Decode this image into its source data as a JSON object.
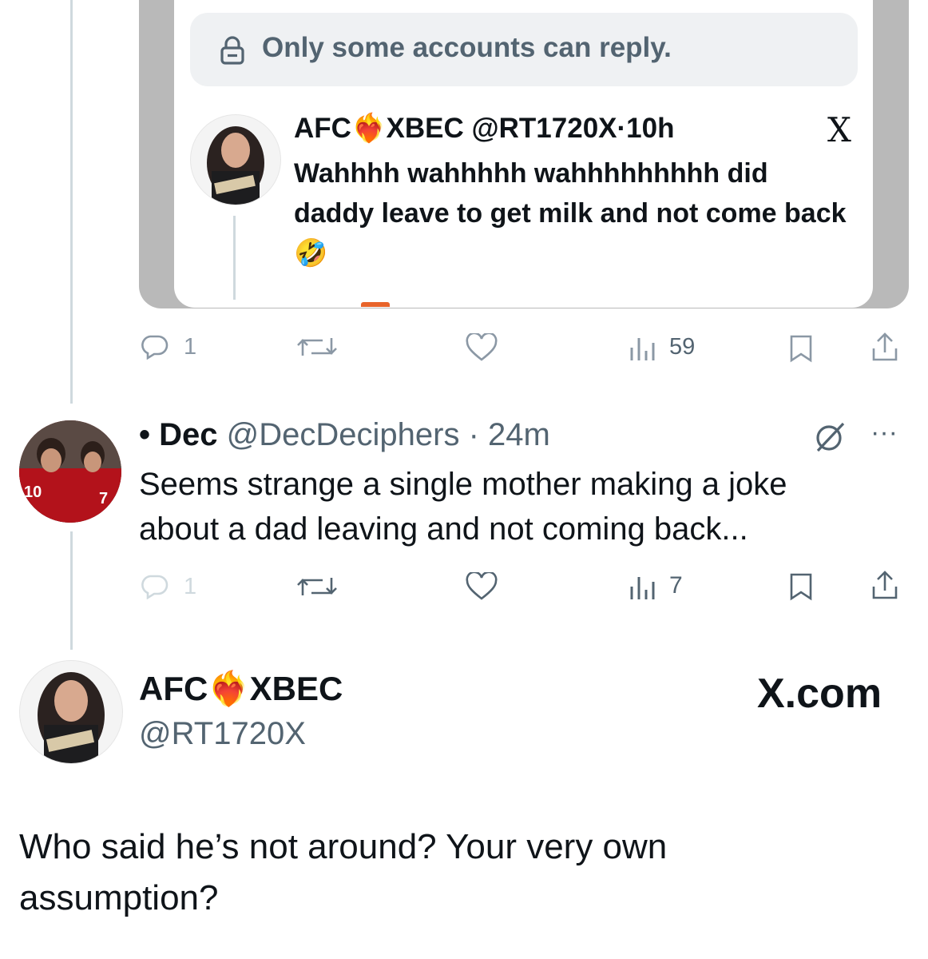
{
  "quoted_post": {
    "reply_notice": "Only some accounts can reply.",
    "author_name_left": "AFC",
    "author_name_right": "XBEC",
    "handle": "@RT1720X",
    "time": "10h",
    "text": "Wahhhh wahhhhh wahhhhhhhhh did daddy leave to get milk and not come back",
    "emoji": "🤣",
    "platform_icon": "X",
    "actions": {
      "replies": "1",
      "views": "59"
    }
  },
  "reply_post": {
    "author": "Dec",
    "handle": "@DecDeciphers",
    "time": "24m",
    "text": "Seems strange a single mother making a joke about a dad leaving and not coming back...",
    "actions": {
      "replies": "1",
      "views": "7"
    },
    "more_icon": "···"
  },
  "main_post": {
    "author_name_left": "AFC",
    "author_name_right": "XBEC",
    "handle": "@RT1720X",
    "brand": "X.com",
    "text": "Who said he’s not around? Your very own assumption?"
  },
  "colors": {
    "secondary_text": "#536471",
    "thread_line": "#cfd9de",
    "accent_heart": "#e0245e"
  }
}
